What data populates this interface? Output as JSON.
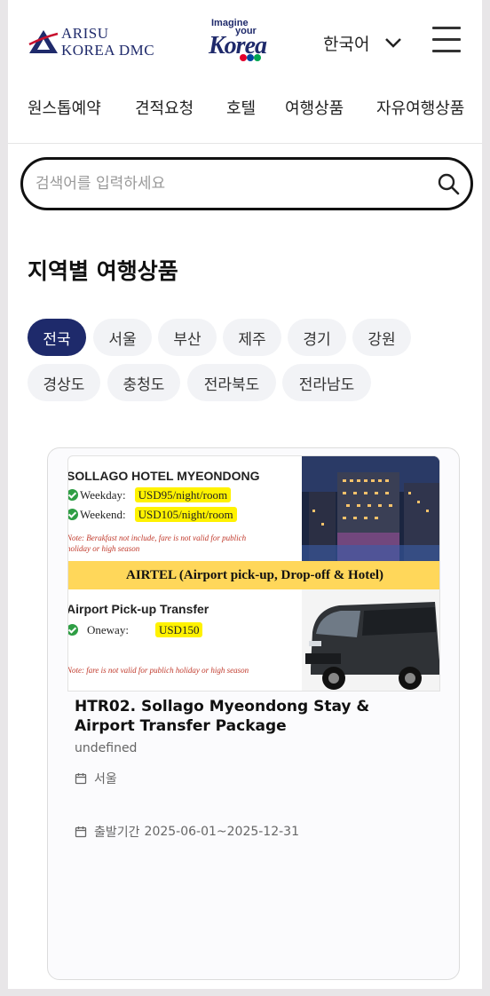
{
  "header": {
    "logo_line1": "ARISU",
    "logo_line2": "KOREA DMC",
    "tourism_logo": {
      "line1": "Imagine",
      "line2": "your",
      "line3": "Korea"
    },
    "language": "한국어"
  },
  "nav": {
    "items": [
      "원스톱예약",
      "견적요청",
      "호텔",
      "여행상품",
      "자유여행상품"
    ]
  },
  "search": {
    "placeholder": "검색어를 입력하세요",
    "value": ""
  },
  "section": {
    "title": "지역별 여행상품",
    "regions": [
      "전국",
      "서울",
      "부산",
      "제주",
      "경기",
      "강원",
      "경상도",
      "충청도",
      "전라북도",
      "전라남도"
    ],
    "active_region": "전국"
  },
  "product": {
    "image": {
      "hotel_name": "SOLLAGO HOTEL MYEONDONG",
      "weekday_label": "Weekday:",
      "weekday_price": "USD95/night/room",
      "weekend_label": "Weekend:",
      "weekend_price": "USD105/night/room",
      "hotel_note_1": "Note: Berakfast not include, fare is not valid for publich",
      "hotel_note_2": "holiday  or high season",
      "banner": "AIRTEL (Airport pick-up, Drop-off & Hotel)",
      "transfer_title": "Airport Pick-up Transfer",
      "oneway_label": "Oneway:",
      "oneway_price": "USD150",
      "transfer_note": "Note: fare is not valid for publich holiday  or high season"
    },
    "title": "HTR02. Sollago Myeondong Stay & Airport Transfer Package",
    "subtitle": "undefined",
    "region": "서울",
    "period_label": "출발기간",
    "period": "2025-06-01~2025-12-31"
  },
  "colors": {
    "brand": "#1e2a6b",
    "chip_bg": "#f2f3f6",
    "highlight": "#fff200",
    "banner": "#ffd75a"
  }
}
